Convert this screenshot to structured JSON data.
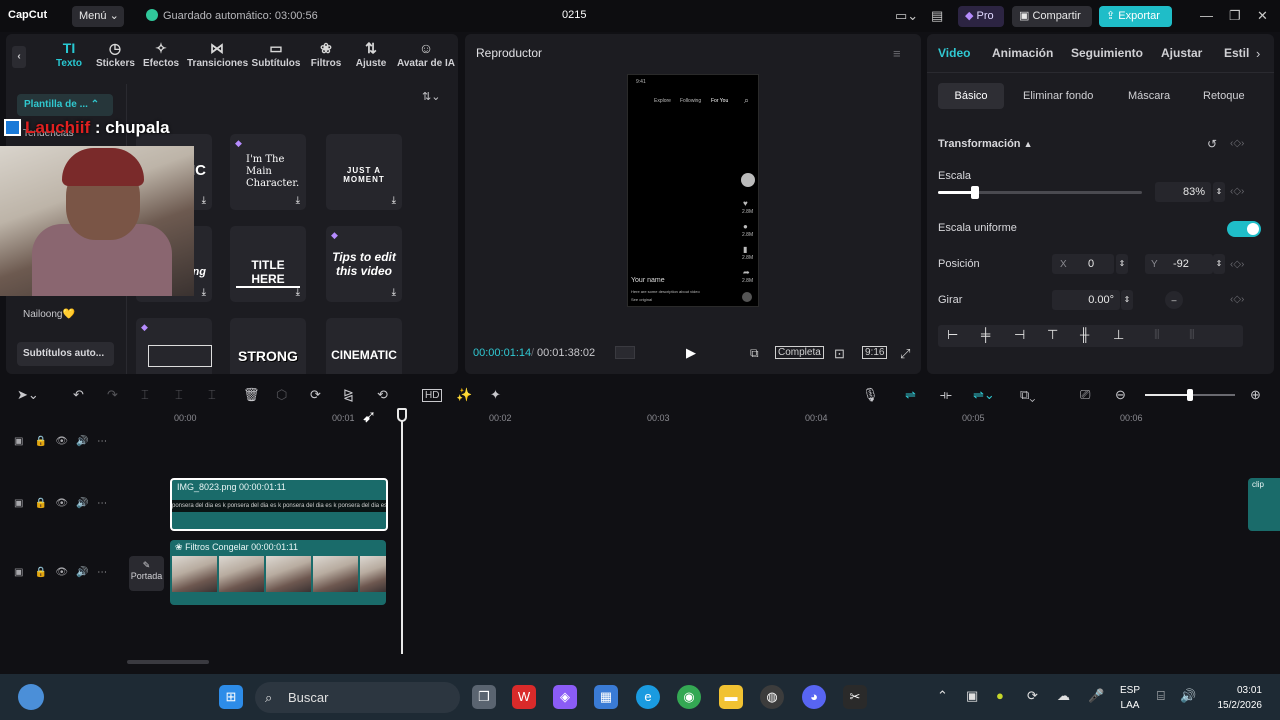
{
  "titlebar": {
    "logo": "CapCut",
    "menu": "Menú",
    "autosave": "Guardado automático: 03:00:56",
    "project": "0215",
    "pro": "Pro",
    "share": "Compartir",
    "export": "Exportar"
  },
  "left": {
    "tabs": [
      {
        "label": "Texto",
        "icon": "TI"
      },
      {
        "label": "Stickers",
        "icon": "◷"
      },
      {
        "label": "Efectos",
        "icon": "✧"
      },
      {
        "label": "Transiciones",
        "icon": "⋈"
      },
      {
        "label": "Subtítulos",
        "icon": "▭"
      },
      {
        "label": "Filtros",
        "icon": "❀"
      },
      {
        "label": "Ajuste",
        "icon": "⇅"
      },
      {
        "label": "Avatar de IA",
        "icon": "☺"
      }
    ],
    "template_btn": "Plantilla de ...",
    "side_items": [
      "Tendencias",
      "Nailoong💛"
    ],
    "sub_auto": "Subtítulos auto...",
    "cards": [
      "IC",
      "I'm The Main Character.",
      "JUST A MOMENT",
      "ing",
      "TITLE HERE",
      "Tips to edit this video",
      "",
      "STRONG",
      "CINEMATIC"
    ]
  },
  "overlay": {
    "user": "Lauchiif",
    "msg": ": chupala"
  },
  "player": {
    "title": "Reproductor",
    "phone_tabs": [
      "Explore",
      "Following",
      "For You"
    ],
    "phone_time": "9:41",
    "phone_name": "Your name",
    "phone_desc": "Here are some description about video",
    "phone_sound": "See original",
    "phone_counts": [
      "2.8M",
      "2.8M",
      "2.8M",
      "2.8M"
    ],
    "current": "00:00:01:14",
    "total": "00:01:38:02",
    "mode": "Completa",
    "ratio": "9:16"
  },
  "right": {
    "tabs": [
      "Video",
      "Animación",
      "Seguimiento",
      "Ajustar",
      "Estil"
    ],
    "subtabs": [
      "Básico",
      "Eliminar fondo",
      "Máscara",
      "Retoque"
    ],
    "transform": "Transformación",
    "scale_label": "Escala",
    "scale_value": "83%",
    "scale_fraction": 0.18,
    "uniform_label": "Escala uniforme",
    "position_label": "Posición",
    "x_label": "X",
    "x_value": "0",
    "y_label": "Y",
    "y_value": "-92",
    "rotate_label": "Girar",
    "rotate_value": "0.00°"
  },
  "timeline": {
    "ruler": [
      "00:00",
      "00:01",
      "00:02",
      "00:03",
      "00:04",
      "00:05",
      "00:06"
    ],
    "clip_main": "IMG_8023.png   00:00:01:11",
    "clip_main_wave": "ponsera del dia es k ponsera del dia es k ponsera del dia es k ponsera del dia es k ponsera del dia es k",
    "clip_vid": "Filtros   Congelar   00:00:01:11",
    "clip_far": "clip",
    "portada": "Portada"
  },
  "taskbar": {
    "search": "Buscar",
    "lang1": "ESP",
    "lang2": "LAA",
    "time": "03:01",
    "date": "15/2/2026"
  }
}
